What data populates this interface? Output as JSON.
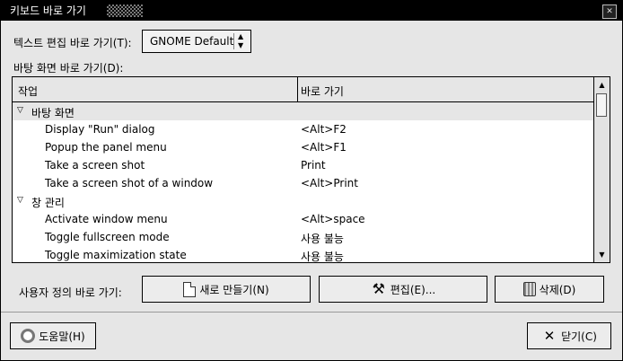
{
  "window": {
    "title": "키보드 바로 가기"
  },
  "text_editing": {
    "label": "텍스트 편집 바로 가기(T):",
    "value": "GNOME Default"
  },
  "desktop_shortcuts": {
    "label": "바탕 화면 바로 가기(D):"
  },
  "table": {
    "headers": [
      "작업",
      "바로 가기"
    ],
    "groups": [
      {
        "label": "바탕 화면",
        "rows": [
          {
            "action": "Display \"Run\" dialog",
            "shortcut": "<Alt>F2"
          },
          {
            "action": "Popup the panel menu",
            "shortcut": "<Alt>F1"
          },
          {
            "action": "Take a screen shot",
            "shortcut": "Print"
          },
          {
            "action": "Take a screen shot of a window",
            "shortcut": "<Alt>Print"
          }
        ]
      },
      {
        "label": "창 관리",
        "rows": [
          {
            "action": "Activate window menu",
            "shortcut": "<Alt>space"
          },
          {
            "action": "Toggle fullscreen mode",
            "shortcut": "사용 불능"
          },
          {
            "action": "Toggle maximization state",
            "shortcut": "사용 불능"
          }
        ]
      }
    ]
  },
  "custom": {
    "label": "사용자 정의 바로 가기:",
    "new_label": "새로 만들기(N)",
    "edit_label": "편집(E)...",
    "delete_label": "삭제(D)"
  },
  "footer": {
    "help_label": "도움말(H)",
    "close_label": "닫기(C)"
  },
  "icons": {
    "new": "new-document-icon",
    "edit": "tools-icon",
    "delete": "trash-icon",
    "help": "lifebuoy-icon",
    "close": "x-mark-icon"
  }
}
